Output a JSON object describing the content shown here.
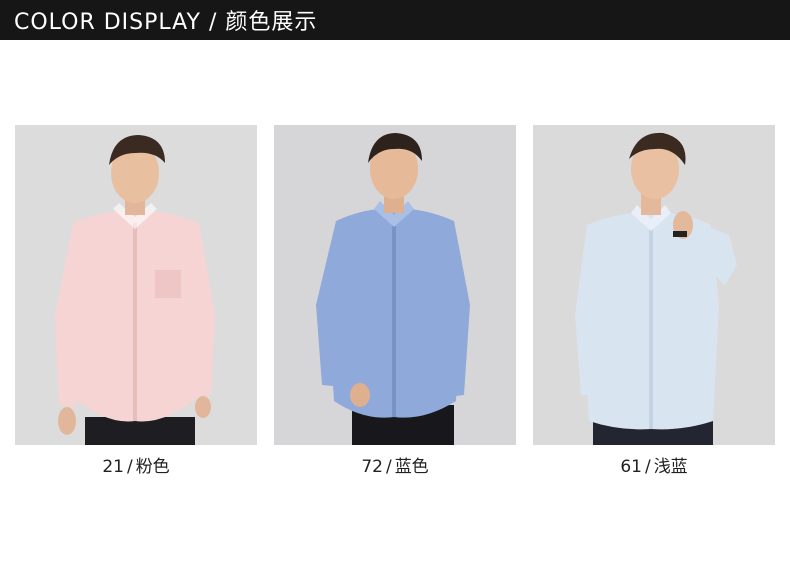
{
  "header": {
    "title": "COLOR DISPLAY / 颜色展示"
  },
  "products": [
    {
      "code": "21",
      "separator": "/",
      "color_name": "粉色",
      "shirt_color": "#f6d4d4",
      "shirt_shade": "#e9bcbc",
      "bg": "#dcdcdc"
    },
    {
      "code": "72",
      "separator": "/",
      "color_name": "蓝色",
      "shirt_color": "#8fa9da",
      "shirt_shade": "#7893c6",
      "bg": "#d6d6d8"
    },
    {
      "code": "61",
      "separator": "/",
      "color_name": "浅蓝",
      "shirt_color": "#d9e4f1",
      "shirt_shade": "#c4d2e4",
      "bg": "#dadada"
    }
  ]
}
